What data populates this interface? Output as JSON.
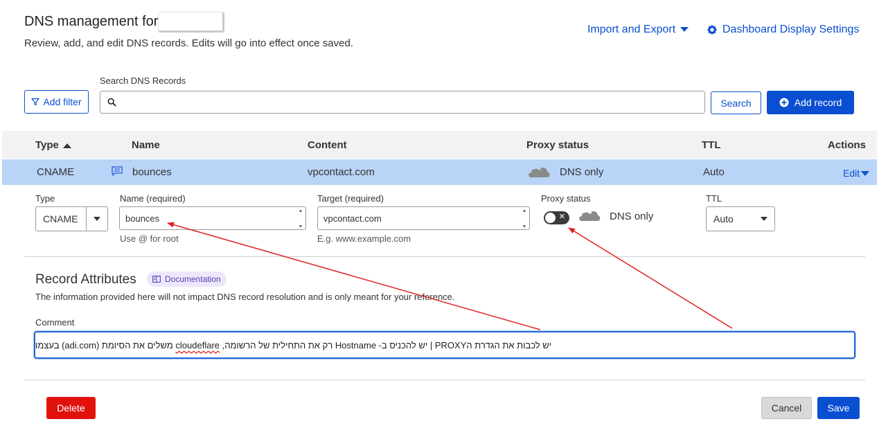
{
  "header": {
    "title": "DNS management for",
    "subtitle": "Review, add, and edit DNS records. Edits will go into effect once saved.",
    "import_export": "Import and Export",
    "dashboard_settings": "Dashboard Display Settings"
  },
  "toolbar": {
    "add_filter": "Add filter",
    "search_label": "Search DNS Records",
    "search_value": "",
    "search_button": "Search",
    "add_record": "Add record"
  },
  "table": {
    "columns": [
      "Type",
      "Name",
      "Content",
      "Proxy status",
      "TTL",
      "Actions"
    ],
    "row": {
      "type": "CNAME",
      "name": "bounces",
      "content": "vpcontact.com",
      "proxy_status": "DNS only",
      "ttl": "Auto",
      "action": "Edit"
    }
  },
  "edit_form": {
    "type_label": "Type",
    "type_value": "CNAME",
    "name_label": "Name (required)",
    "name_value": "bounces",
    "name_hint": "Use @ for root",
    "target_label": "Target (required)",
    "target_value": "vpcontact.com",
    "target_hint": "E.g. www.example.com",
    "proxy_label": "Proxy status",
    "proxy_value": "DNS only",
    "proxy_enabled": false,
    "ttl_label": "TTL",
    "ttl_value": "Auto"
  },
  "attributes": {
    "title": "Record Attributes",
    "doc_badge": "Documentation",
    "description": "The information provided here will not impact DNS record resolution and is only meant for your reference.",
    "comment_label": "Comment",
    "comment_part1": "יש לכבות את הגדרת הPROXY  |  יש להכניס ב- Hostname רק את התחילית של הרשומה, ",
    "comment_part2": "cloudeflare",
    "comment_part3": " משלים את הסיומת (adi.com) בעצמו"
  },
  "footer": {
    "delete": "Delete",
    "cancel": "Cancel",
    "save": "Save"
  },
  "colors": {
    "primary": "#0a4fd1",
    "danger": "#e0120b",
    "row_highlight": "#b9d4f7",
    "annotation_arrow": "#e02020"
  }
}
